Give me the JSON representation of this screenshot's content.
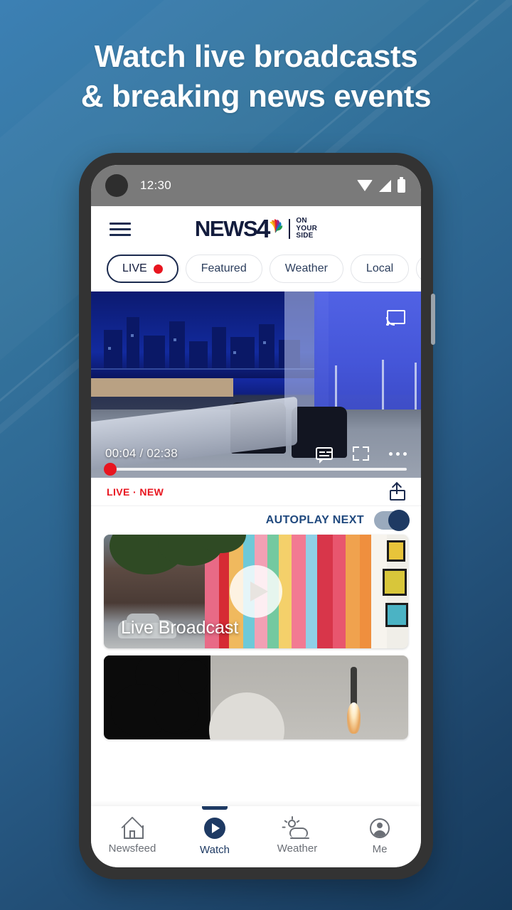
{
  "promo": {
    "headline_line1": "Watch live broadcasts",
    "headline_line2": "& breaking news events"
  },
  "status_bar": {
    "time": "12:30",
    "icons": [
      "wifi-icon",
      "cellular-signal-icon",
      "battery-icon"
    ]
  },
  "app_header": {
    "menu_icon": "hamburger-menu-icon",
    "logo": {
      "word": "NEWS",
      "channel": "4",
      "peacock": "nbc-peacock-icon",
      "tagline_line1": "ON",
      "tagline_line2": "YOUR",
      "tagline_line3": "SIDE"
    }
  },
  "tabs": [
    {
      "label": "LIVE",
      "active": true,
      "has_live_dot": true
    },
    {
      "label": "Featured",
      "active": false,
      "has_live_dot": false
    },
    {
      "label": "Weather",
      "active": false,
      "has_live_dot": false
    },
    {
      "label": "Local",
      "active": false,
      "has_live_dot": false
    }
  ],
  "video_player": {
    "current_time": "00:04",
    "separator": " / ",
    "total_time": "02:38",
    "progress_percent": 3,
    "cast_icon": "chromecast-icon",
    "captions_icon": "closed-caption-icon",
    "fullscreen_icon": "fullscreen-icon",
    "more_icon": "more-options-icon",
    "scene": "news studio set with city skyline backdrop and anchor desk"
  },
  "meta_bar": {
    "badge": "LIVE · NEW",
    "share_icon": "share-icon"
  },
  "autoplay": {
    "label": "AUTOPLAY NEXT",
    "enabled": true
  },
  "cards": [
    {
      "title": "Live Broadcast",
      "play_icon": "play-button-icon",
      "scene": "colorful YOU ARE BEAUTIFUL street mural with parked car"
    },
    {
      "title": "",
      "scene": "rocket launch at dusk seen through dark foliage"
    }
  ],
  "bottom_nav": [
    {
      "label": "Newsfeed",
      "icon": "home-icon",
      "active": false
    },
    {
      "label": "Watch",
      "icon": "play-circle-icon",
      "active": true
    },
    {
      "label": "Weather",
      "icon": "sun-cloud-icon",
      "active": false
    },
    {
      "label": "Me",
      "icon": "person-icon",
      "active": false
    }
  ],
  "colors": {
    "background_top": "#3c80b4",
    "background_bottom": "#163a5c",
    "brand_navy": "#1b2a4e",
    "live_red": "#e8151f",
    "accent_blue": "#1e3a63",
    "autoplay_label": "#20497e"
  }
}
